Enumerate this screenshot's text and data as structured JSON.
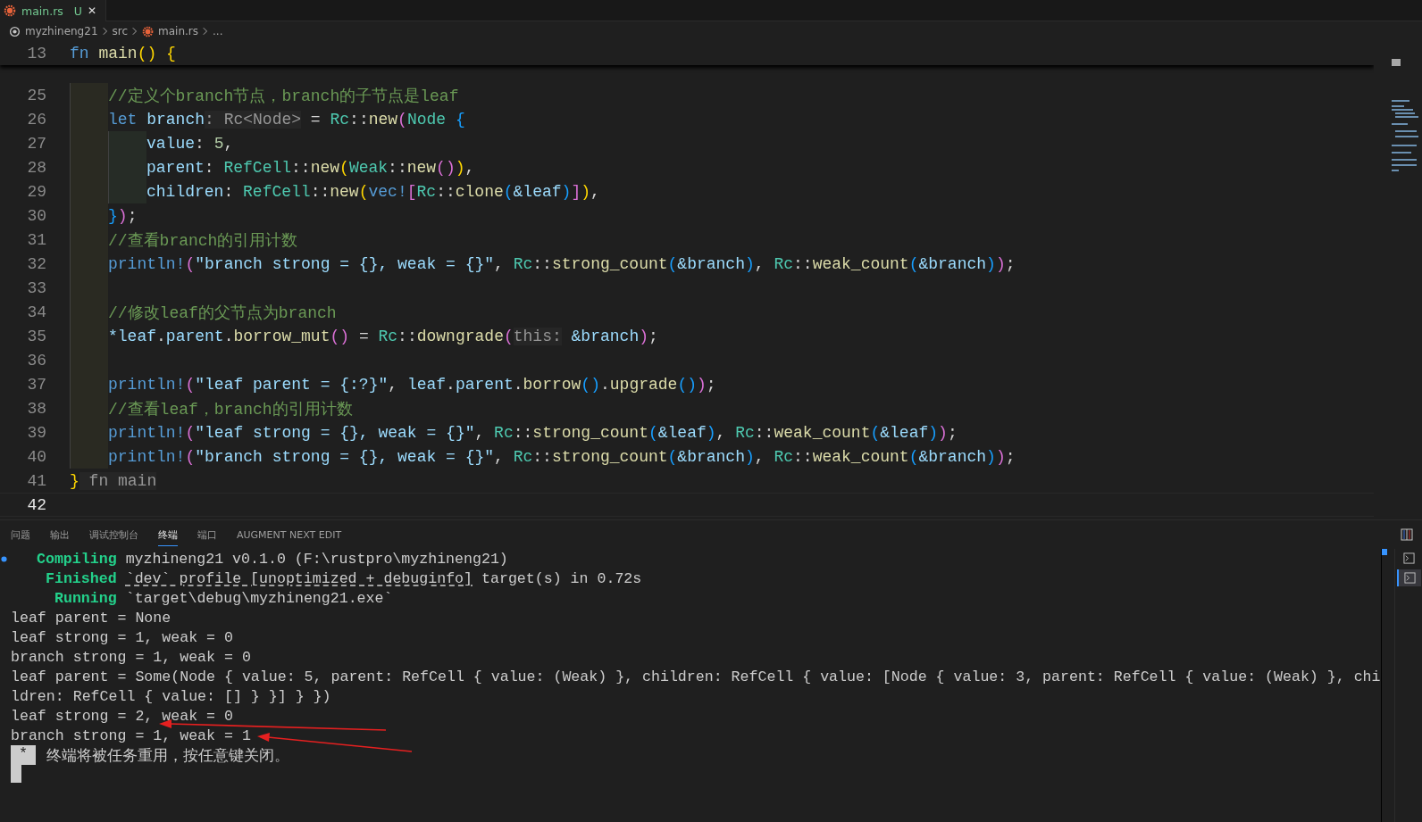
{
  "tab": {
    "filename": "main.rs",
    "git_status": "U",
    "close": "✕",
    "selected": true
  },
  "breadcrumb": [
    "myzhineng21",
    "src",
    "main.rs",
    "..."
  ],
  "sticky_line": {
    "number": "13",
    "tokens": [
      {
        "text": "fn ",
        "kind": "kw"
      },
      {
        "text": "main",
        "kind": "fn"
      },
      {
        "text": "()",
        "kind": "b1"
      },
      {
        "text": " {",
        "kind": "b1"
      }
    ]
  },
  "code_lines": [
    {
      "number": "25",
      "kind": "body",
      "tokens": [
        {
          "text": "//定义个branch节点，branch的子节点是leaf",
          "kind": "cmt"
        }
      ]
    },
    {
      "number": "26",
      "kind": "body",
      "tokens": [
        {
          "text": "let ",
          "kind": "kw"
        },
        {
          "text": "branch",
          "kind": "var"
        },
        {
          "text": ": Rc<Node>",
          "kind": "hint"
        },
        {
          "text": " = ",
          "kind": "p"
        },
        {
          "text": "Rc",
          "kind": "type"
        },
        {
          "text": "::",
          "kind": "p"
        },
        {
          "text": "new",
          "kind": "fn"
        },
        {
          "text": "(",
          "kind": "b2"
        },
        {
          "text": "Node ",
          "kind": "type"
        },
        {
          "text": "{",
          "kind": "b3"
        }
      ]
    },
    {
      "number": "27",
      "kind": "nested",
      "tokens": [
        {
          "text": "value",
          "kind": "var"
        },
        {
          "text": ": ",
          "kind": "p"
        },
        {
          "text": "5",
          "kind": "num"
        },
        {
          "text": ",",
          "kind": "p"
        }
      ]
    },
    {
      "number": "28",
      "kind": "nested",
      "tokens": [
        {
          "text": "parent",
          "kind": "var"
        },
        {
          "text": ": ",
          "kind": "p"
        },
        {
          "text": "RefCell",
          "kind": "type"
        },
        {
          "text": "::",
          "kind": "p"
        },
        {
          "text": "new",
          "kind": "fn"
        },
        {
          "text": "(",
          "kind": "b1"
        },
        {
          "text": "Weak",
          "kind": "type"
        },
        {
          "text": "::",
          "kind": "p"
        },
        {
          "text": "new",
          "kind": "fn"
        },
        {
          "text": "()",
          "kind": "b2"
        },
        {
          "text": ")",
          "kind": "b1"
        },
        {
          "text": ",",
          "kind": "p"
        }
      ]
    },
    {
      "number": "29",
      "kind": "nested",
      "tokens": [
        {
          "text": "children",
          "kind": "var"
        },
        {
          "text": ": ",
          "kind": "p"
        },
        {
          "text": "RefCell",
          "kind": "type"
        },
        {
          "text": "::",
          "kind": "p"
        },
        {
          "text": "new",
          "kind": "fn"
        },
        {
          "text": "(",
          "kind": "b1"
        },
        {
          "text": "vec!",
          "kind": "kw"
        },
        {
          "text": "[",
          "kind": "b2"
        },
        {
          "text": "Rc",
          "kind": "type"
        },
        {
          "text": "::",
          "kind": "p"
        },
        {
          "text": "clone",
          "kind": "fn"
        },
        {
          "text": "(",
          "kind": "b3"
        },
        {
          "text": "&leaf",
          "kind": "var"
        },
        {
          "text": ")",
          "kind": "b3"
        },
        {
          "text": "]",
          "kind": "b2"
        },
        {
          "text": ")",
          "kind": "b1"
        },
        {
          "text": ",",
          "kind": "p"
        }
      ]
    },
    {
      "number": "30",
      "kind": "body",
      "tokens": [
        {
          "text": "}",
          "kind": "b3"
        },
        {
          "text": ")",
          "kind": "b2"
        },
        {
          "text": ";",
          "kind": "p"
        }
      ]
    },
    {
      "number": "31",
      "kind": "body",
      "tokens": [
        {
          "text": "//查看branch的引用计数",
          "kind": "cmt"
        }
      ]
    },
    {
      "number": "32",
      "kind": "body",
      "tokens": [
        {
          "text": "println!",
          "kind": "kw"
        },
        {
          "text": "(",
          "kind": "b2"
        },
        {
          "text": "\"branch strong = {}, weak = {}\"",
          "kind": "str"
        },
        {
          "text": ", ",
          "kind": "p"
        },
        {
          "text": "Rc",
          "kind": "type"
        },
        {
          "text": "::",
          "kind": "p"
        },
        {
          "text": "strong_count",
          "kind": "fn"
        },
        {
          "text": "(",
          "kind": "b3"
        },
        {
          "text": "&branch",
          "kind": "var"
        },
        {
          "text": ")",
          "kind": "b3"
        },
        {
          "text": ", ",
          "kind": "p"
        },
        {
          "text": "Rc",
          "kind": "type"
        },
        {
          "text": "::",
          "kind": "p"
        },
        {
          "text": "weak_count",
          "kind": "fn"
        },
        {
          "text": "(",
          "kind": "b3"
        },
        {
          "text": "&branch",
          "kind": "var"
        },
        {
          "text": ")",
          "kind": "b3"
        },
        {
          "text": ")",
          "kind": "b2"
        },
        {
          "text": ";",
          "kind": "p"
        }
      ]
    },
    {
      "number": "33",
      "kind": "body"
    },
    {
      "number": "34",
      "kind": "body",
      "tokens": [
        {
          "text": "//修改leaf的父节点为branch",
          "kind": "cmt"
        }
      ]
    },
    {
      "number": "35",
      "kind": "body",
      "tokens": [
        {
          "text": "*leaf",
          "kind": "var"
        },
        {
          "text": ".",
          "kind": "p"
        },
        {
          "text": "parent",
          "kind": "var"
        },
        {
          "text": ".",
          "kind": "p"
        },
        {
          "text": "borrow_mut",
          "kind": "fn"
        },
        {
          "text": "()",
          "kind": "b2"
        },
        {
          "text": " = ",
          "kind": "p"
        },
        {
          "text": "Rc",
          "kind": "type"
        },
        {
          "text": "::",
          "kind": "p"
        },
        {
          "text": "downgrade",
          "kind": "fn"
        },
        {
          "text": "(",
          "kind": "b2"
        },
        {
          "text": "this:",
          "kind": "hint"
        },
        {
          "text": " &branch",
          "kind": "var"
        },
        {
          "text": ")",
          "kind": "b2"
        },
        {
          "text": ";",
          "kind": "p"
        }
      ]
    },
    {
      "number": "36",
      "kind": "body"
    },
    {
      "number": "37",
      "kind": "body",
      "tokens": [
        {
          "text": "println!",
          "kind": "kw"
        },
        {
          "text": "(",
          "kind": "b2"
        },
        {
          "text": "\"leaf parent = {:?}\"",
          "kind": "str"
        },
        {
          "text": ", ",
          "kind": "p"
        },
        {
          "text": "leaf",
          "kind": "var"
        },
        {
          "text": ".",
          "kind": "p"
        },
        {
          "text": "parent",
          "kind": "var"
        },
        {
          "text": ".",
          "kind": "p"
        },
        {
          "text": "borrow",
          "kind": "fn"
        },
        {
          "text": "()",
          "kind": "b3"
        },
        {
          "text": ".",
          "kind": "p"
        },
        {
          "text": "upgrade",
          "kind": "fn"
        },
        {
          "text": "()",
          "kind": "b3"
        },
        {
          "text": ")",
          "kind": "b2"
        },
        {
          "text": ";",
          "kind": "p"
        }
      ]
    },
    {
      "number": "38",
      "kind": "body",
      "tokens": [
        {
          "text": "//查看leaf，branch的引用计数",
          "kind": "cmt"
        }
      ]
    },
    {
      "number": "39",
      "kind": "body",
      "tokens": [
        {
          "text": "println!",
          "kind": "kw"
        },
        {
          "text": "(",
          "kind": "b2"
        },
        {
          "text": "\"leaf strong = {}, weak = {}\"",
          "kind": "str"
        },
        {
          "text": ", ",
          "kind": "p"
        },
        {
          "text": "Rc",
          "kind": "type"
        },
        {
          "text": "::",
          "kind": "p"
        },
        {
          "text": "strong_count",
          "kind": "fn"
        },
        {
          "text": "(",
          "kind": "b3"
        },
        {
          "text": "&leaf",
          "kind": "var"
        },
        {
          "text": ")",
          "kind": "b3"
        },
        {
          "text": ", ",
          "kind": "p"
        },
        {
          "text": "Rc",
          "kind": "type"
        },
        {
          "text": "::",
          "kind": "p"
        },
        {
          "text": "weak_count",
          "kind": "fn"
        },
        {
          "text": "(",
          "kind": "b3"
        },
        {
          "text": "&leaf",
          "kind": "var"
        },
        {
          "text": ")",
          "kind": "b3"
        },
        {
          "text": ")",
          "kind": "b2"
        },
        {
          "text": ";",
          "kind": "p"
        }
      ]
    },
    {
      "number": "40",
      "kind": "body",
      "tokens": [
        {
          "text": "println!",
          "kind": "kw"
        },
        {
          "text": "(",
          "kind": "b2"
        },
        {
          "text": "\"branch strong = {}, weak = {}\"",
          "kind": "str"
        },
        {
          "text": ", ",
          "kind": "p"
        },
        {
          "text": "Rc",
          "kind": "type"
        },
        {
          "text": "::",
          "kind": "p"
        },
        {
          "text": "strong_count",
          "kind": "fn"
        },
        {
          "text": "(",
          "kind": "b3"
        },
        {
          "text": "&branch",
          "kind": "var"
        },
        {
          "text": ")",
          "kind": "b3"
        },
        {
          "text": ", ",
          "kind": "p"
        },
        {
          "text": "Rc",
          "kind": "type"
        },
        {
          "text": "::",
          "kind": "p"
        },
        {
          "text": "weak_count",
          "kind": "fn"
        },
        {
          "text": "(",
          "kind": "b3"
        },
        {
          "text": "&branch",
          "kind": "var"
        },
        {
          "text": ")",
          "kind": "b3"
        },
        {
          "text": ")",
          "kind": "b2"
        },
        {
          "text": ";",
          "kind": "p"
        }
      ]
    },
    {
      "number": "41",
      "kind": "top",
      "tokens": [
        {
          "text": "}",
          "kind": "b1"
        },
        {
          "text": " fn main",
          "kind": "hint"
        }
      ]
    },
    {
      "number": "42",
      "kind": "top",
      "current": true
    }
  ],
  "panel_tabs": [
    {
      "label": "问题",
      "selected": false
    },
    {
      "label": "输出",
      "selected": false
    },
    {
      "label": "调试控制台",
      "selected": false
    },
    {
      "label": "终端",
      "selected": true
    },
    {
      "label": "端口",
      "selected": false
    },
    {
      "label": "AUGMENT NEXT EDIT",
      "selected": false
    }
  ],
  "terminal_lines": [
    {
      "kind": "cargo",
      "status": "Compiling",
      "parts": [
        {
          "text": "myzhineng21 v0.1.0 (F:\\rustpro\\myzhineng21)",
          "kind": "plain"
        }
      ]
    },
    {
      "kind": "cargo",
      "status": "Finished",
      "parts": [
        {
          "text": "`dev` profile [unoptimized + debuginfo]",
          "kind": "link"
        },
        {
          "text": "target(s) in 0.72s",
          "kind": "plain"
        }
      ]
    },
    {
      "kind": "cargo",
      "status": "Running",
      "parts": [
        {
          "text": "`target\\debug\\myzhineng21.exe`",
          "kind": "plain"
        }
      ]
    },
    {
      "kind": "output",
      "text": "leaf parent = None"
    },
    {
      "kind": "output",
      "text": "leaf strong = 1, weak = 0"
    },
    {
      "kind": "output",
      "text": "branch strong = 1, weak = 0"
    },
    {
      "kind": "output",
      "text": "leaf parent = Some(Node { value: 5, parent: RefCell { value: (Weak) }, children: RefCell { value: [Node { value: 3, parent: RefCell { value: (Weak) }, chi"
    },
    {
      "kind": "output",
      "text": "ldren: RefCell { value: [] } }] } })"
    },
    {
      "kind": "output",
      "text": "leaf strong = 2, weak = 0"
    },
    {
      "kind": "output",
      "text": "branch strong = 1, weak = 1"
    },
    {
      "kind": "notice",
      "marker": "*",
      "text": "终端将被任务重用，按任意键关闭。"
    }
  ]
}
